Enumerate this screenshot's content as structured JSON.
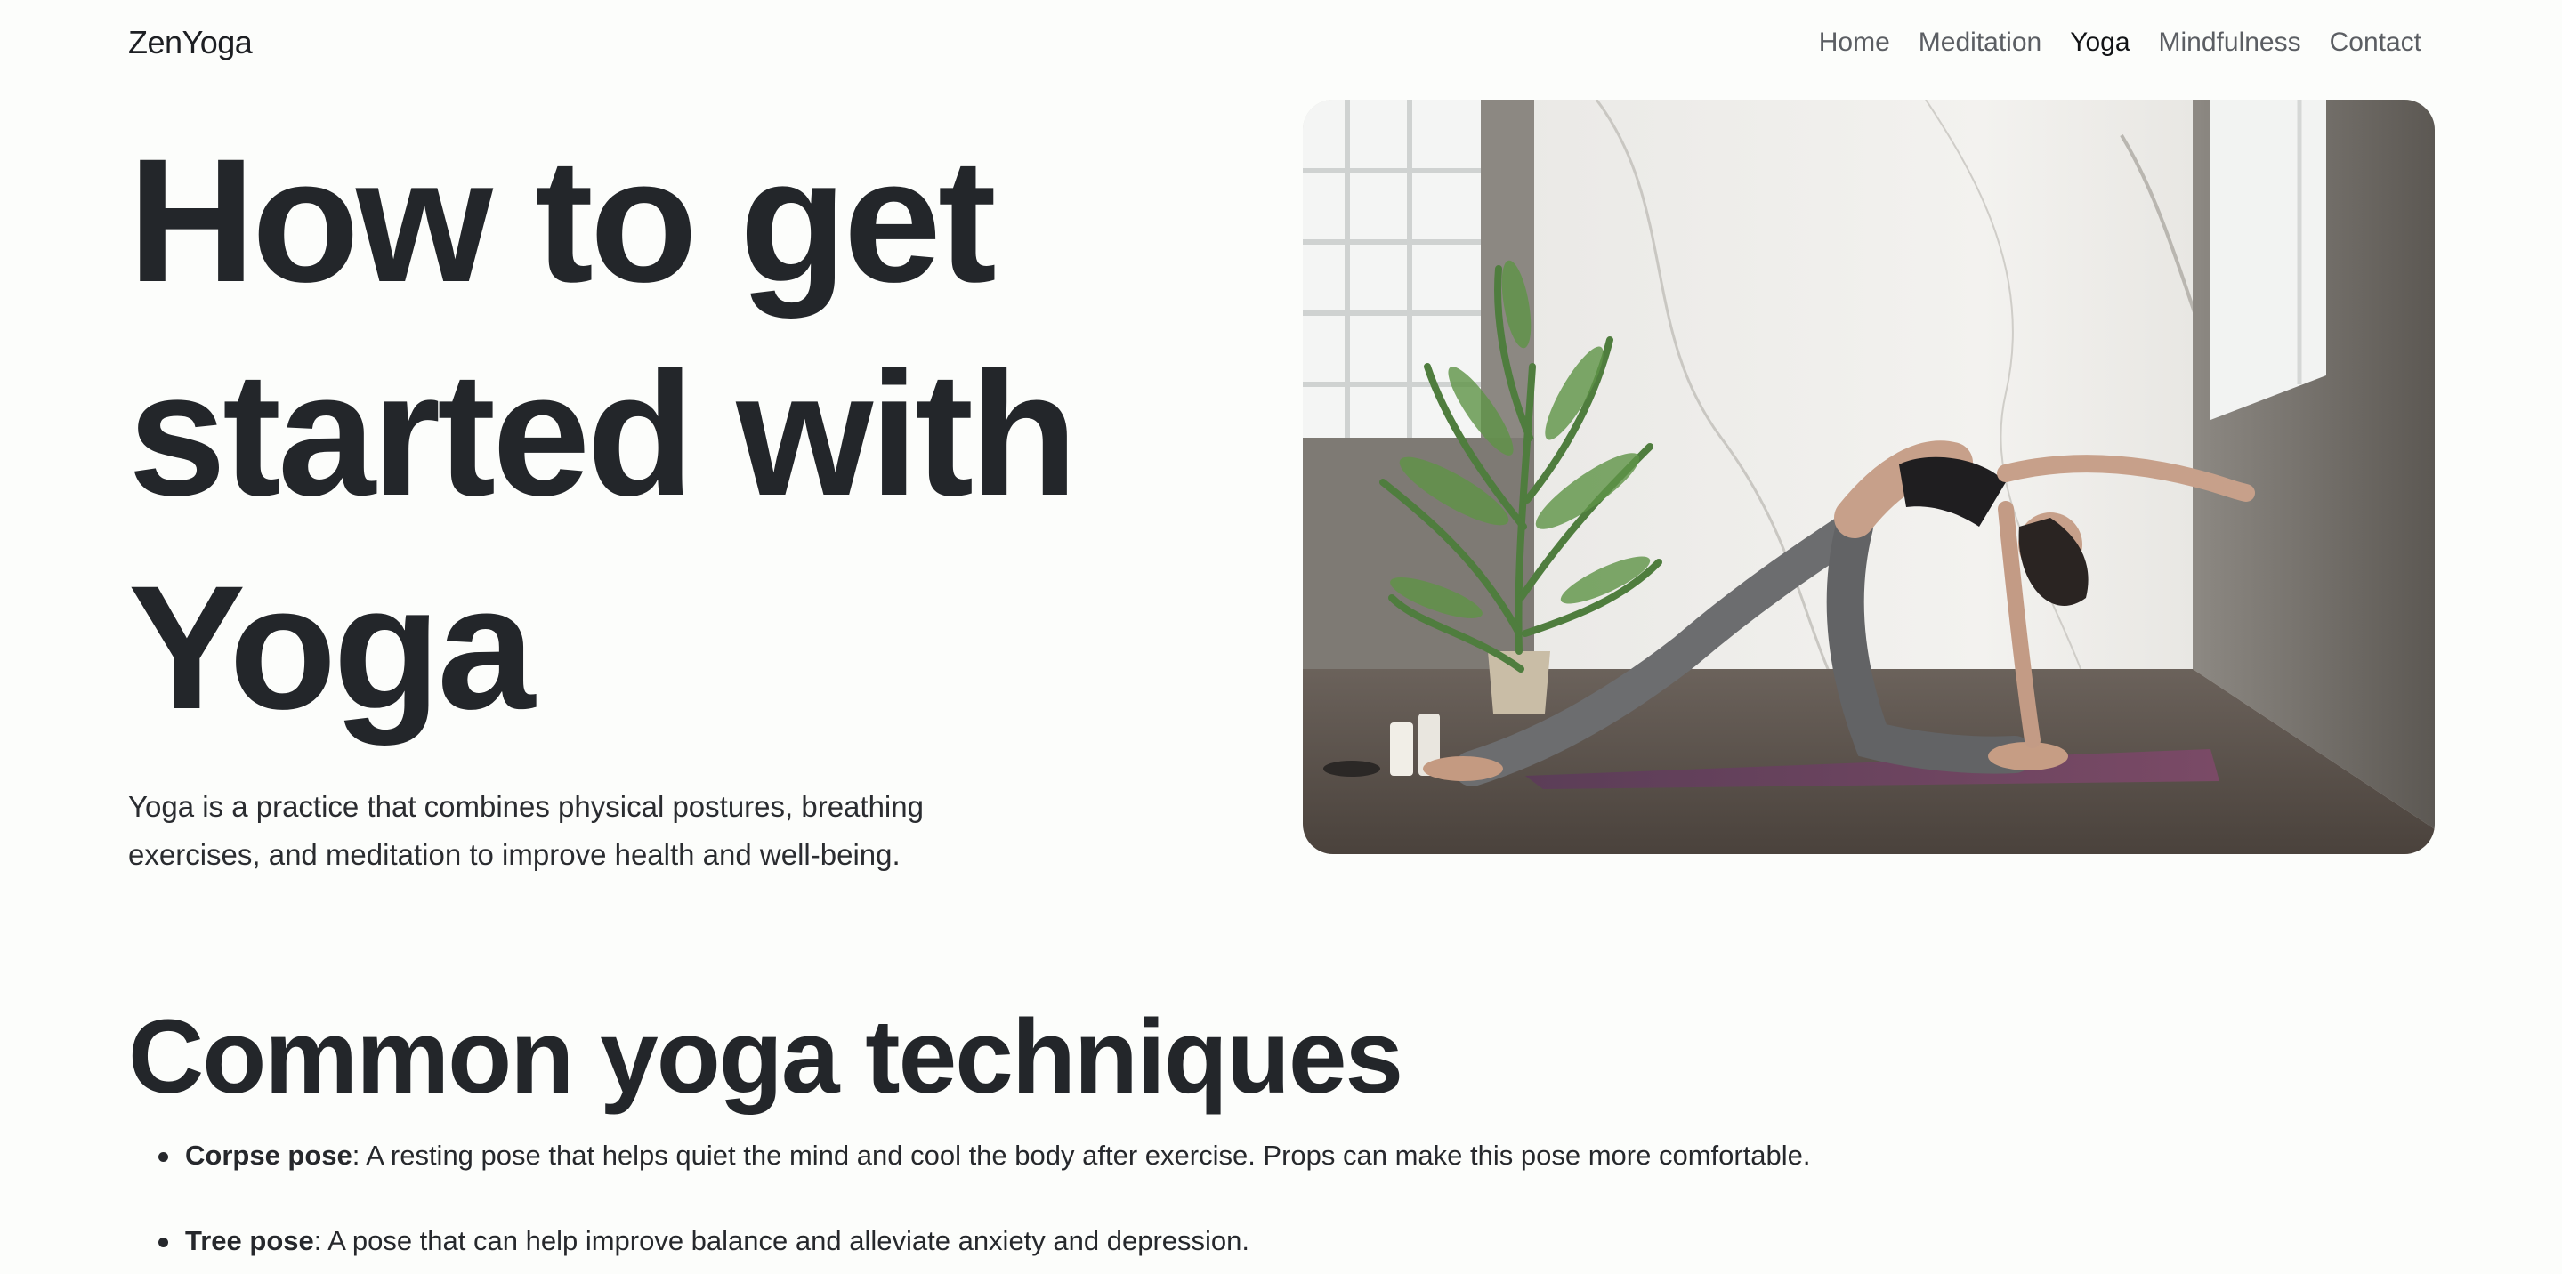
{
  "nav": {
    "brand": "ZenYoga",
    "links": [
      {
        "label": "Home",
        "active": false
      },
      {
        "label": "Meditation",
        "active": false
      },
      {
        "label": "Yoga",
        "active": true
      },
      {
        "label": "Mindfulness",
        "active": false
      },
      {
        "label": "Contact",
        "active": false
      }
    ]
  },
  "hero": {
    "title": "How to get started with Yoga",
    "lead": "Yoga is a practice that combines physical postures, breathing exercises, and meditation to improve health and well-being."
  },
  "techniques": {
    "heading": "Common yoga techniques",
    "items": [
      {
        "name": "Corpse pose",
        "description": ": A resting pose that helps quiet the mind and cool the body after exercise. Props can make this pose more comfortable."
      },
      {
        "name": "Tree pose",
        "description": ": A pose that can help improve balance and alleviate anxiety and depression."
      }
    ]
  }
}
